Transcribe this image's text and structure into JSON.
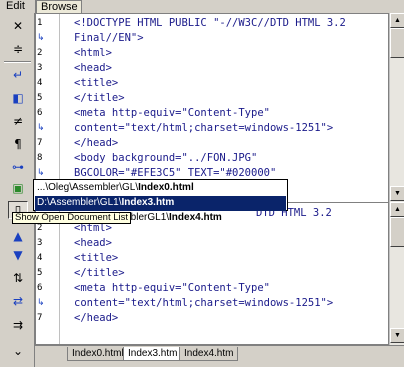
{
  "top_tabs": {
    "edit": "Edit",
    "browse": "Browse"
  },
  "toolbar_icons": [
    "close-icon",
    "scroll-icon",
    "word-wrap-icon",
    "split-left-icon",
    "not-equal-icon",
    "paragraph-icon",
    "link-icon",
    "monitor-icon",
    "document-list-icon",
    "arrow-up-icon",
    "arrow-down-icon",
    "sort-icon",
    "move-icon",
    "line-sort-icon",
    "expand-more-icon"
  ],
  "editor_top": {
    "lines": [
      {
        "num": "1",
        "text": "<!DOCTYPE HTML PUBLIC \"-//W3C//DTD HTML 3.2"
      },
      {
        "num": "",
        "wrap": true,
        "text": "Final//EN\">"
      },
      {
        "num": "2",
        "text": "<html>"
      },
      {
        "num": "3",
        "text": "<head>"
      },
      {
        "num": "4",
        "text": "<title>"
      },
      {
        "num": "5",
        "text": "</title>"
      },
      {
        "num": "6",
        "text": "<meta http-equiv=\"Content-Type\""
      },
      {
        "num": "",
        "wrap": true,
        "text": "content=\"text/html;charset=windows-1251\">"
      },
      {
        "num": "7",
        "text": "</head>"
      },
      {
        "num": "8",
        "text": "<body background=\"../FON.JPG\""
      },
      {
        "num": "",
        "wrap": true,
        "text": "BGCOLOR=\"#EFE3C5\" TEXT=\"#020000\""
      }
    ]
  },
  "editor_bottom": {
    "lines": [
      {
        "num": "",
        "text": "DTD HTML 3.2"
      },
      {
        "num": "2",
        "text": "<html>"
      },
      {
        "num": "3",
        "text": "<head>"
      },
      {
        "num": "4",
        "text": "<title>"
      },
      {
        "num": "5",
        "text": "</title>"
      },
      {
        "num": "6",
        "text": "<meta http-equiv=\"Content-Type\""
      },
      {
        "num": "",
        "wrap": true,
        "text": "content=\"text/html;charset=windows-1251\">"
      },
      {
        "num": "7",
        "text": "</head>"
      }
    ]
  },
  "popup": {
    "items": [
      {
        "path": "...\\Oleg\\Assembler\\GL\\",
        "file": "Index0.html"
      },
      {
        "path": "D:\\Assembler\\GL1\\",
        "file": "Index3.htm"
      },
      {
        "path": "...\\AssemblerGL1\\",
        "file": "Index4.htm"
      }
    ]
  },
  "tooltip": "Show Open Document List",
  "doc_tabs": [
    "Index0.html",
    "Index3.htm",
    "Index4.htm"
  ],
  "colors": {
    "code_text": "#1a1a8a",
    "selection": "#0a246a",
    "tooltip_bg": "#ffffe1"
  }
}
